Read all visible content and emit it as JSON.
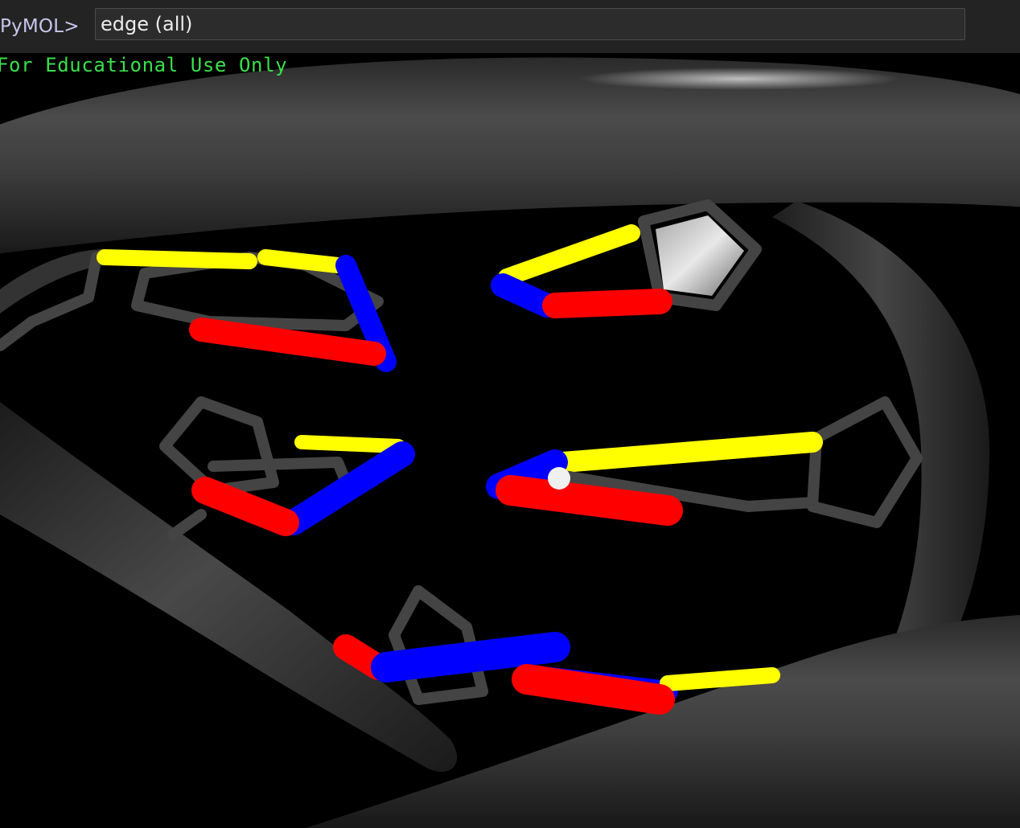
{
  "window": {
    "background": "#000000",
    "toolbar_background": "#232323"
  },
  "command_line": {
    "prompt": "PyMOL>",
    "value": "edge (all)"
  },
  "viewport": {
    "watermark": "For Educational Use Only",
    "watermark_color": "#3ae04a",
    "representation": "sticks and cartoon",
    "element_colors": {
      "carbon": "#3a3a3a",
      "oxygen": "#ff0000",
      "nitrogen": "#0000ff",
      "phosphorus_sulfur": "#ffff00",
      "hydrogen": "#ffffff"
    }
  }
}
